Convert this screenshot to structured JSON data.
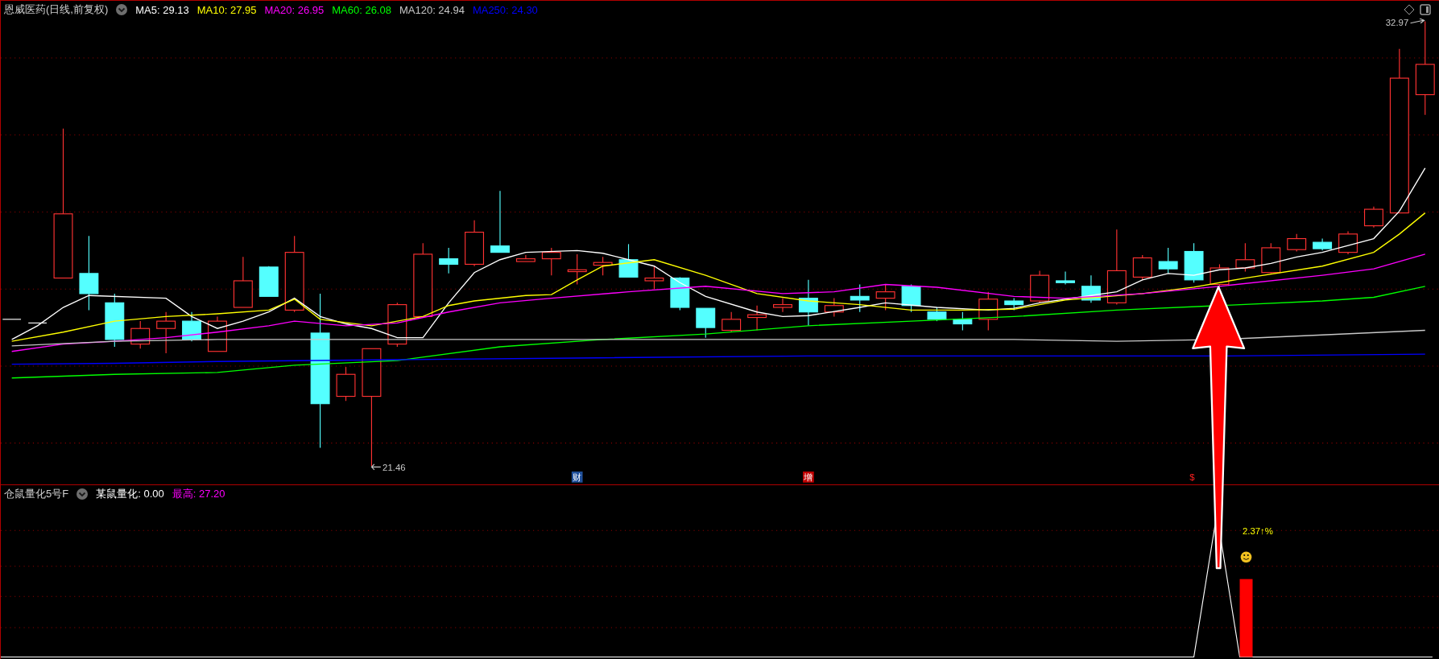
{
  "main_panel": {
    "title": "恩威医药(日线,前复权)",
    "indicators": [
      {
        "label": "MA5: 29.13",
        "color": "#ffffff"
      },
      {
        "label": "MA10: 27.95",
        "color": "#ffff00"
      },
      {
        "label": "MA20: 26.95",
        "color": "#ff00ff"
      },
      {
        "label": "MA60: 26.08",
        "color": "#00ff00"
      },
      {
        "label": "MA120: 24.94",
        "color": "#c8c8c8"
      },
      {
        "label": "MA250: 24.30",
        "color": "#0000ff"
      }
    ],
    "high_label": "32.97",
    "low_label": "21.46",
    "event_markers": [
      {
        "text": "财",
        "kind": "finance"
      },
      {
        "text": "增",
        "kind": "increase"
      },
      {
        "text": "$",
        "kind": "dollar"
      }
    ]
  },
  "sub_panel": {
    "title": "仓鼠量化5号F",
    "indicators": [
      {
        "label": "某鼠量化: 0.00",
        "color": "#ffffff"
      },
      {
        "label": "最高: 27.20",
        "color": "#ff00ff"
      }
    ],
    "percent_label": "2.37↑%"
  }
}
